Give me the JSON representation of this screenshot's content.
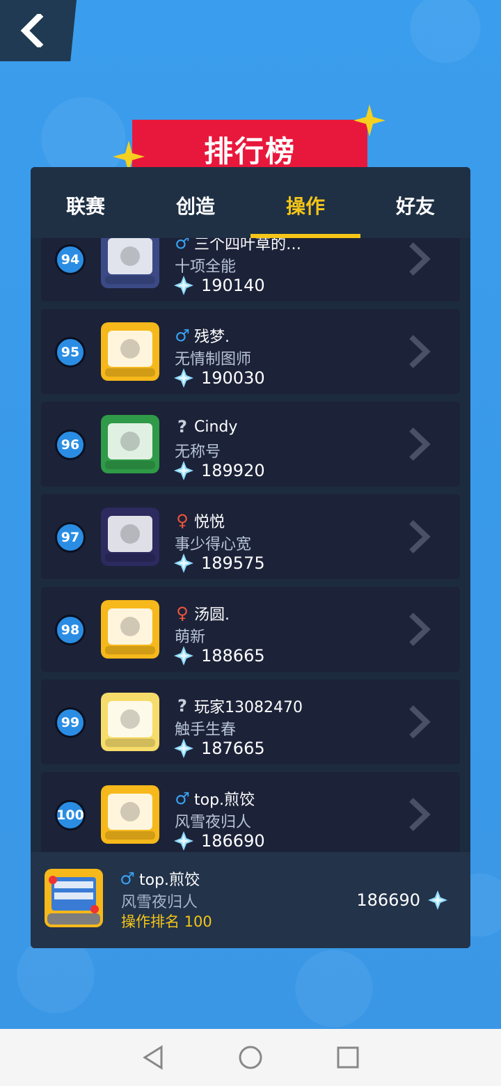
{
  "header": {
    "title": "排行榜"
  },
  "tabs": [
    {
      "label": "联赛",
      "active": false
    },
    {
      "label": "创造",
      "active": false
    },
    {
      "label": "操作",
      "active": true
    },
    {
      "label": "好友",
      "active": false
    }
  ],
  "rows": [
    {
      "rank": "94",
      "gender": "male",
      "name": "三个四叶草的…",
      "title": "十项全能",
      "score": "190140",
      "avatar_color": "#3b4a86"
    },
    {
      "rank": "95",
      "gender": "male",
      "name": "残梦.",
      "title": "无情制图师",
      "score": "190030",
      "avatar_color": "#f6b81a"
    },
    {
      "rank": "96",
      "gender": "unknown",
      "name": "Cindy",
      "title": "无称号",
      "score": "189920",
      "avatar_color": "#2f9a47"
    },
    {
      "rank": "97",
      "gender": "female",
      "name": "悦悦",
      "title": "事少得心宽",
      "score": "189575",
      "avatar_color": "#2c2a5e"
    },
    {
      "rank": "98",
      "gender": "female",
      "name": "汤圆.",
      "title": "萌新",
      "score": "188665",
      "avatar_color": "#f6b81a"
    },
    {
      "rank": "99",
      "gender": "unknown",
      "name": "玩家13082470",
      "title": "触手生春",
      "score": "187665",
      "avatar_color": "#f6dc6a"
    },
    {
      "rank": "100",
      "gender": "male",
      "name": "top.煎饺",
      "title": "风雪夜归人",
      "score": "186690",
      "avatar_color": "#f6b81a"
    }
  ],
  "me": {
    "gender": "male",
    "name": "top.煎饺",
    "title": "风雪夜归人",
    "rank_text": "操作排名 100",
    "score": "186690"
  },
  "gender_symbols": {
    "male": "♂",
    "female": "♀",
    "unknown": "?"
  },
  "colors": {
    "accent": "#f5c518",
    "ribbon": "#e8183c",
    "rank_badge": "#2a8de3",
    "panel": "#1d2b3e"
  }
}
